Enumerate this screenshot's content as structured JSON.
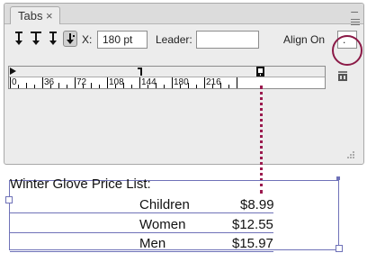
{
  "panel": {
    "tab_label": "Tabs",
    "close_glyph": "×",
    "minimize_glyph": "–",
    "x_label": "X:",
    "x_value": "180 pt",
    "leader_label": "Leader:",
    "leader_value": "",
    "align_on_label": "Align On",
    "align_on_value": ".",
    "tab_buttons": [
      "left-justified-tab",
      "center-justified-tab",
      "right-justified-tab",
      "align-to-decimal-tab"
    ],
    "selected_tab_button": "align-to-decimal-tab",
    "ruler_labels": [
      "0",
      "36",
      "72",
      "108",
      "144",
      "180",
      "216"
    ],
    "highlight_color": "#8b1a47"
  },
  "document": {
    "title": "Winter Glove Price List:",
    "rows": [
      {
        "item": "Children",
        "price": "$8.99"
      },
      {
        "item": "Women",
        "price": "$12.55"
      },
      {
        "item": "Men",
        "price": "$15.97"
      }
    ],
    "frame_color": "#6f72b8"
  }
}
